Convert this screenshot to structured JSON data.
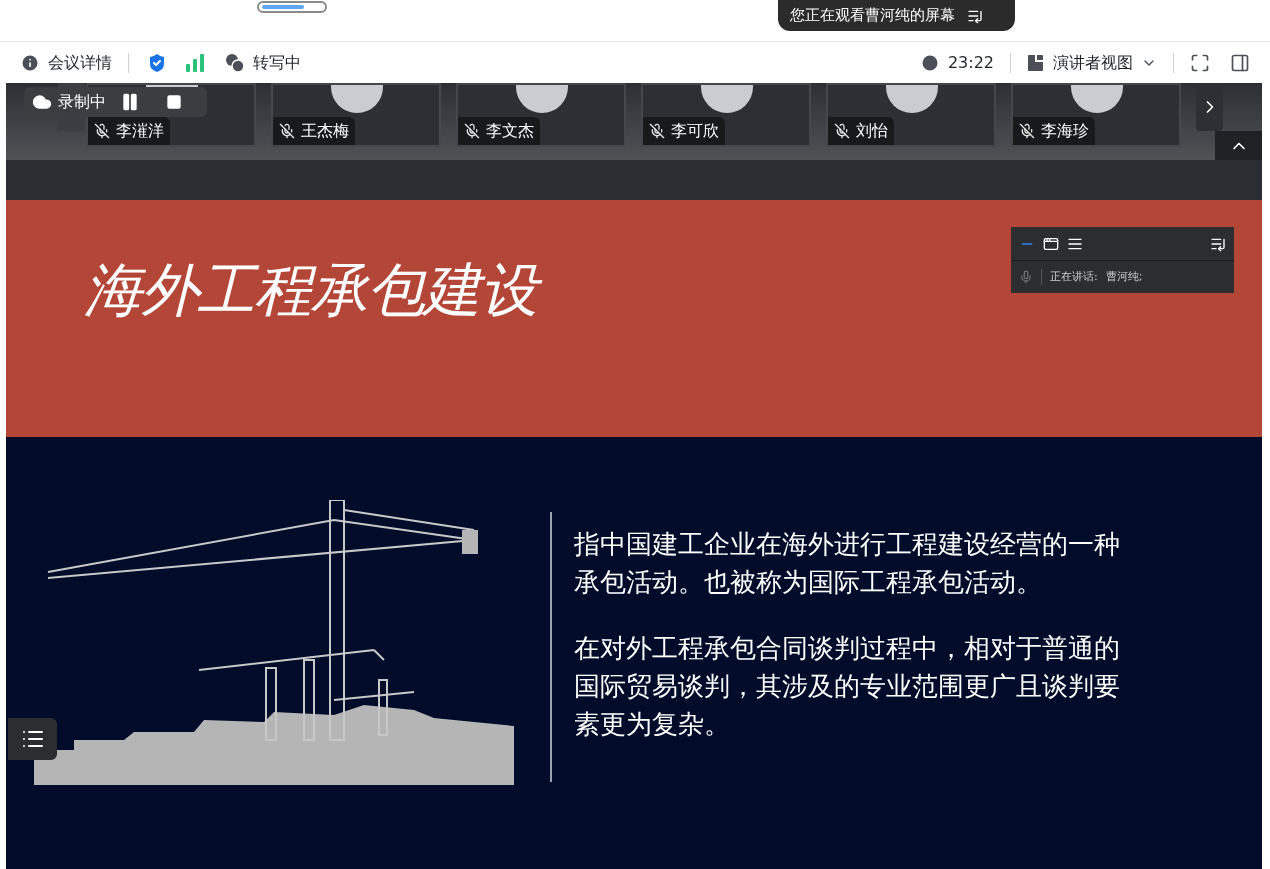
{
  "share_banner": {
    "text": "您正在观看曹河纯的屏幕"
  },
  "toolbar": {
    "meeting_details": "会议详情",
    "transcription": "转写中",
    "time": "23:22",
    "view_mode": "演讲者视图"
  },
  "participants": [
    {
      "name": "李漼洋",
      "muted": true
    },
    {
      "name": "王杰梅",
      "muted": true
    },
    {
      "name": "李文杰",
      "muted": true
    },
    {
      "name": "李可欣",
      "muted": true
    },
    {
      "name": "刘怡",
      "muted": true
    },
    {
      "name": "李海珍",
      "muted": true
    }
  ],
  "recording": {
    "label": "录制中"
  },
  "slide": {
    "title": "海外工程承包建设",
    "paragraphs": [
      "指中国建工企业在海外进行工程建设经营的一种承包活动。也被称为国际工程承包活动。",
      "在对外工程承包合同谈判过程中，相对于普通的国际贸易谈判，其涉及的专业范围更广且谈判要素更为复杂。"
    ]
  },
  "speaker_panel": {
    "label": "正在讲话:",
    "speaker": "曹河纯;"
  }
}
